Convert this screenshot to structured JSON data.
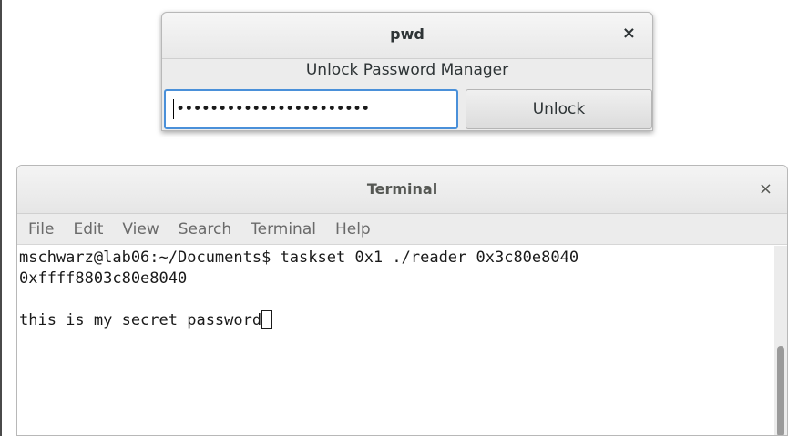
{
  "dialog": {
    "title": "pwd",
    "close_glyph": "×",
    "subtitle": "Unlock Password Manager",
    "password_masked": "•••••••••••••••••••••••",
    "unlock_label": "Unlock"
  },
  "terminal": {
    "title": "Terminal",
    "close_glyph": "×",
    "menu": [
      "File",
      "Edit",
      "View",
      "Search",
      "Terminal",
      "Help"
    ],
    "lines": [
      "mschwarz@lab06:~/Documents$ taskset 0x1 ./reader 0x3c80e8040",
      "0xffff8803c80e8040",
      "",
      "this is my secret password"
    ]
  },
  "colors": {
    "focus_border": "#4a90d9",
    "window_bg": "#ececec"
  }
}
